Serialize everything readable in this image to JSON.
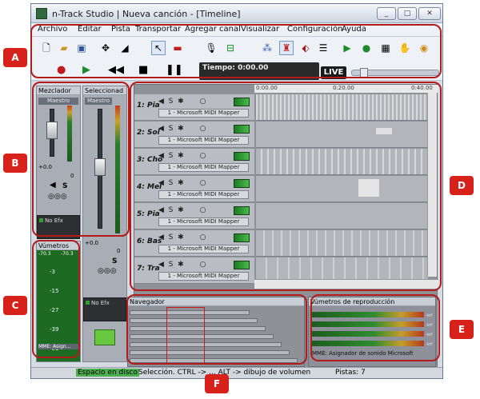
{
  "window": {
    "title": "n-Track Studio | Nueva canción - [Timeline]",
    "min": "_",
    "max": "□",
    "close": "✕"
  },
  "menu": [
    "Archivo",
    "Editar",
    "Pista",
    "Transportar",
    "Agregar canal",
    "Visualizar",
    "Configuración",
    "Ayuda"
  ],
  "transport": {
    "time": "Tiempo: 0:00.00",
    "live": "LIVE"
  },
  "mixer": {
    "title": "Mezclador",
    "close": "×",
    "master": "Maestro",
    "gain": "+0.0",
    "pan": "0",
    "solo": "S",
    "efx": "No Efx"
  },
  "selection": {
    "title": "Seleccionad",
    "master": "Maestro",
    "gain": "+0.0",
    "pan": "0",
    "solo": "S",
    "efx": "No Efx"
  },
  "vumeters": {
    "title": "Vúmetros",
    "left": "-70.3",
    "right": "-70.3",
    "scale": [
      "-3",
      "-15",
      "-27",
      "-39",
      "-51"
    ],
    "device": "MME: Asign..."
  },
  "tracks": [
    {
      "name": "1: Pia",
      "device": "1 - Microsoft MIDI Mapper"
    },
    {
      "name": "2: Sol",
      "device": "1 - Microsoft MIDI Mapper"
    },
    {
      "name": "3: Cho",
      "device": "1 - Microsoft MIDI Mapper"
    },
    {
      "name": "4: Mel",
      "device": "1 - Microsoft MIDI Mapper"
    },
    {
      "name": "5: Pia",
      "device": "1 - Microsoft MIDI Mapper"
    },
    {
      "name": "6: Bas",
      "device": "1 - Microsoft MIDI Mapper"
    },
    {
      "name": "7: Tra",
      "device": "1 - Microsoft MIDI Mapper"
    }
  ],
  "ruler": [
    "0:00.00",
    "0:20.00",
    "0:40.00"
  ],
  "navigator": {
    "title": "Navegador",
    "close": "×"
  },
  "playback": {
    "title": "Vúmetros de reproducción",
    "close": "×",
    "device": "MME: Asignador de sonido Microsoft",
    "scale": [
      "-inf",
      "-inf",
      "-inf",
      "-inf"
    ]
  },
  "status": {
    "disk": "Espacio en disco",
    "hint": "Selección. CTRL -> ... ALT -> dibujo de volumen",
    "tracks": "Pistas: 7"
  },
  "callouts": [
    "A",
    "B",
    "C",
    "D",
    "E",
    "F"
  ],
  "colors": {
    "callout": "#d6221a",
    "meter_green": "#2c7d2e",
    "timeline_bg": "#8f9198"
  }
}
